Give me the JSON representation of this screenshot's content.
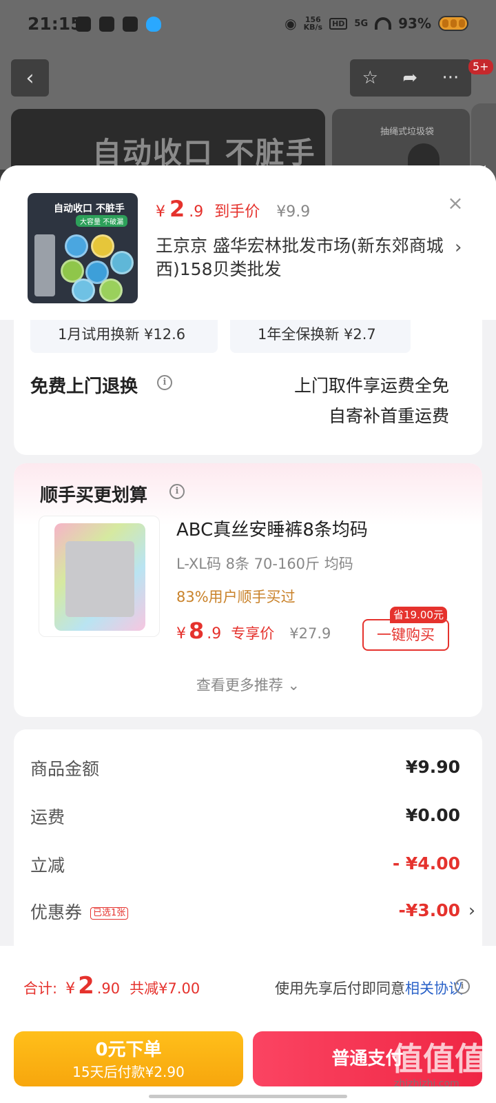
{
  "status": {
    "time": "21:15",
    "net_speed_value": "156",
    "net_speed_unit": "KB/s",
    "hd": "HD",
    "signal": "5G",
    "battery": "93%"
  },
  "header": {
    "badge": "5+",
    "banner_text": "自动收口 不脏手",
    "side_banner_text": "抽绳式垃圾袋"
  },
  "product": {
    "thumb_title": "自动收口 不脏手",
    "thumb_sub": "大容量 不破漏",
    "currency": "¥",
    "price_int": "2",
    "price_dec": ".9",
    "price_tag": "到手价",
    "orig_price": "¥9.9",
    "shop": "王京京  盛华宏林批发市场(新东郊商城西)158贝类批发"
  },
  "service": {
    "opt1": "1月试用换新  ¥12.6",
    "opt2": "1年全保换新  ¥2.7",
    "return_title": "免费上门退换",
    "return_line1": "上门取件享运费全免",
    "return_line2": "自寄补首重运费"
  },
  "recommend": {
    "title": "顺手买更划算",
    "name": "ABC真丝安睡裤8条均码",
    "spec": "L-XL码 8条 70-160斤 均码",
    "stat": "83%用户顺手买过",
    "currency": "¥",
    "price_int": "8",
    "price_dec": ".9",
    "price_tag": "专享价",
    "orig_price": "¥27.9",
    "save_badge": "省19.00元",
    "buy_label": "一键购买",
    "more_label": "查看更多推荐 ⌄"
  },
  "summary": {
    "rows": [
      {
        "label": "商品金额",
        "value": "¥9.90"
      },
      {
        "label": "运费",
        "value": "¥0.00"
      },
      {
        "label": "立减",
        "value": "- ¥4.00"
      },
      {
        "label": "优惠券",
        "value": "-¥3.00",
        "badge": "已选1张"
      }
    ]
  },
  "footer": {
    "total_label": "合计:",
    "currency": "¥",
    "total_int": "2",
    "total_dec": ".90",
    "total_save": "共减¥7.00",
    "agree_text": "使用先享后付即同意",
    "agree_link": "相关协议",
    "pay_later_l1": "0元下单",
    "pay_later_l2": "15天后付款¥2.90",
    "pay_normal": "普通支付",
    "watermark": "值值值",
    "watermark_url": "zhizhizhi.com"
  }
}
